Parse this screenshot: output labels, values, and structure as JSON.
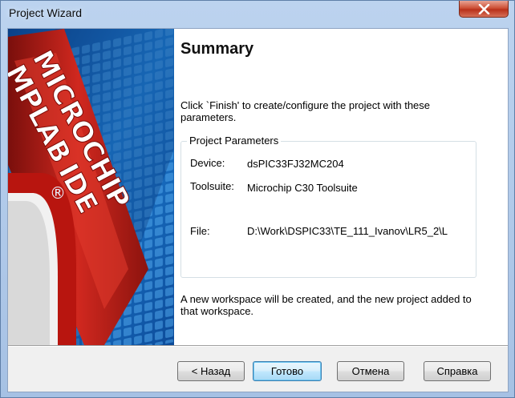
{
  "window": {
    "title": "Project Wizard",
    "close_icon": "close-icon"
  },
  "banner": {
    "brand_line1": "MICROCHIP",
    "brand_line2": "MPLAB",
    "brand_line3": "IDE",
    "registered_mark": "®"
  },
  "page": {
    "heading": "Summary",
    "intro": "Click `Finish' to create/configure the project with these parameters.",
    "group_title": "Project Parameters",
    "params": {
      "device_label": "Device:",
      "device_value": "dsPIC33FJ32MC204",
      "toolsuite_label": "Toolsuite:",
      "toolsuite_value": "Microchip C30 Toolsuite",
      "file_label": "File:",
      "file_value": "D:\\Work\\DSPIC33\\TE_111_Ivanov\\LR5_2\\L"
    },
    "outro": "A new workspace will be created, and the new project added to that workspace."
  },
  "buttons": {
    "back": "< Назад",
    "finish": "Готово",
    "cancel": "Отмена",
    "help": "Справка"
  },
  "colors": {
    "accent_red": "#c8231c",
    "banner_blue": "#1b6fc2",
    "default_button_border": "#3c7fb1"
  }
}
